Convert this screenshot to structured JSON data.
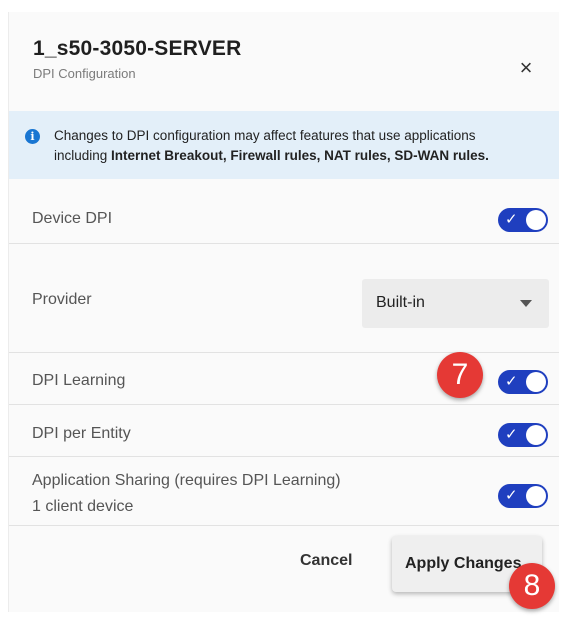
{
  "dialog": {
    "title": "1_s50-3050-SERVER",
    "subtitle": "DPI Configuration",
    "close_label": "×"
  },
  "banner": {
    "icon": "info-icon",
    "line1": "Changes to DPI configuration may affect features that use applications",
    "line2_prefix": "including ",
    "line2_bold": "Internet Breakout, Firewall rules, NAT rules, SD-WAN rules."
  },
  "settings": {
    "device_dpi": {
      "label": "Device DPI",
      "enabled": true
    },
    "provider": {
      "label": "Provider",
      "value": "Built-in"
    },
    "dpi_learning": {
      "label": "DPI Learning",
      "enabled": true
    },
    "dpi_per_entity": {
      "label": "DPI per Entity",
      "enabled": true
    },
    "app_sharing": {
      "label": "Application Sharing (requires DPI Learning)",
      "sublabel": "1 client device",
      "enabled": true
    }
  },
  "toggle_check": "✓",
  "footer": {
    "cancel_label": "Cancel",
    "apply_label": "Apply Changes"
  },
  "annotations": {
    "step7": "7",
    "step8": "8"
  },
  "colors": {
    "toggle_on": "#1f3fbf",
    "banner_bg": "#e3eff9",
    "badge": "#e53935"
  }
}
